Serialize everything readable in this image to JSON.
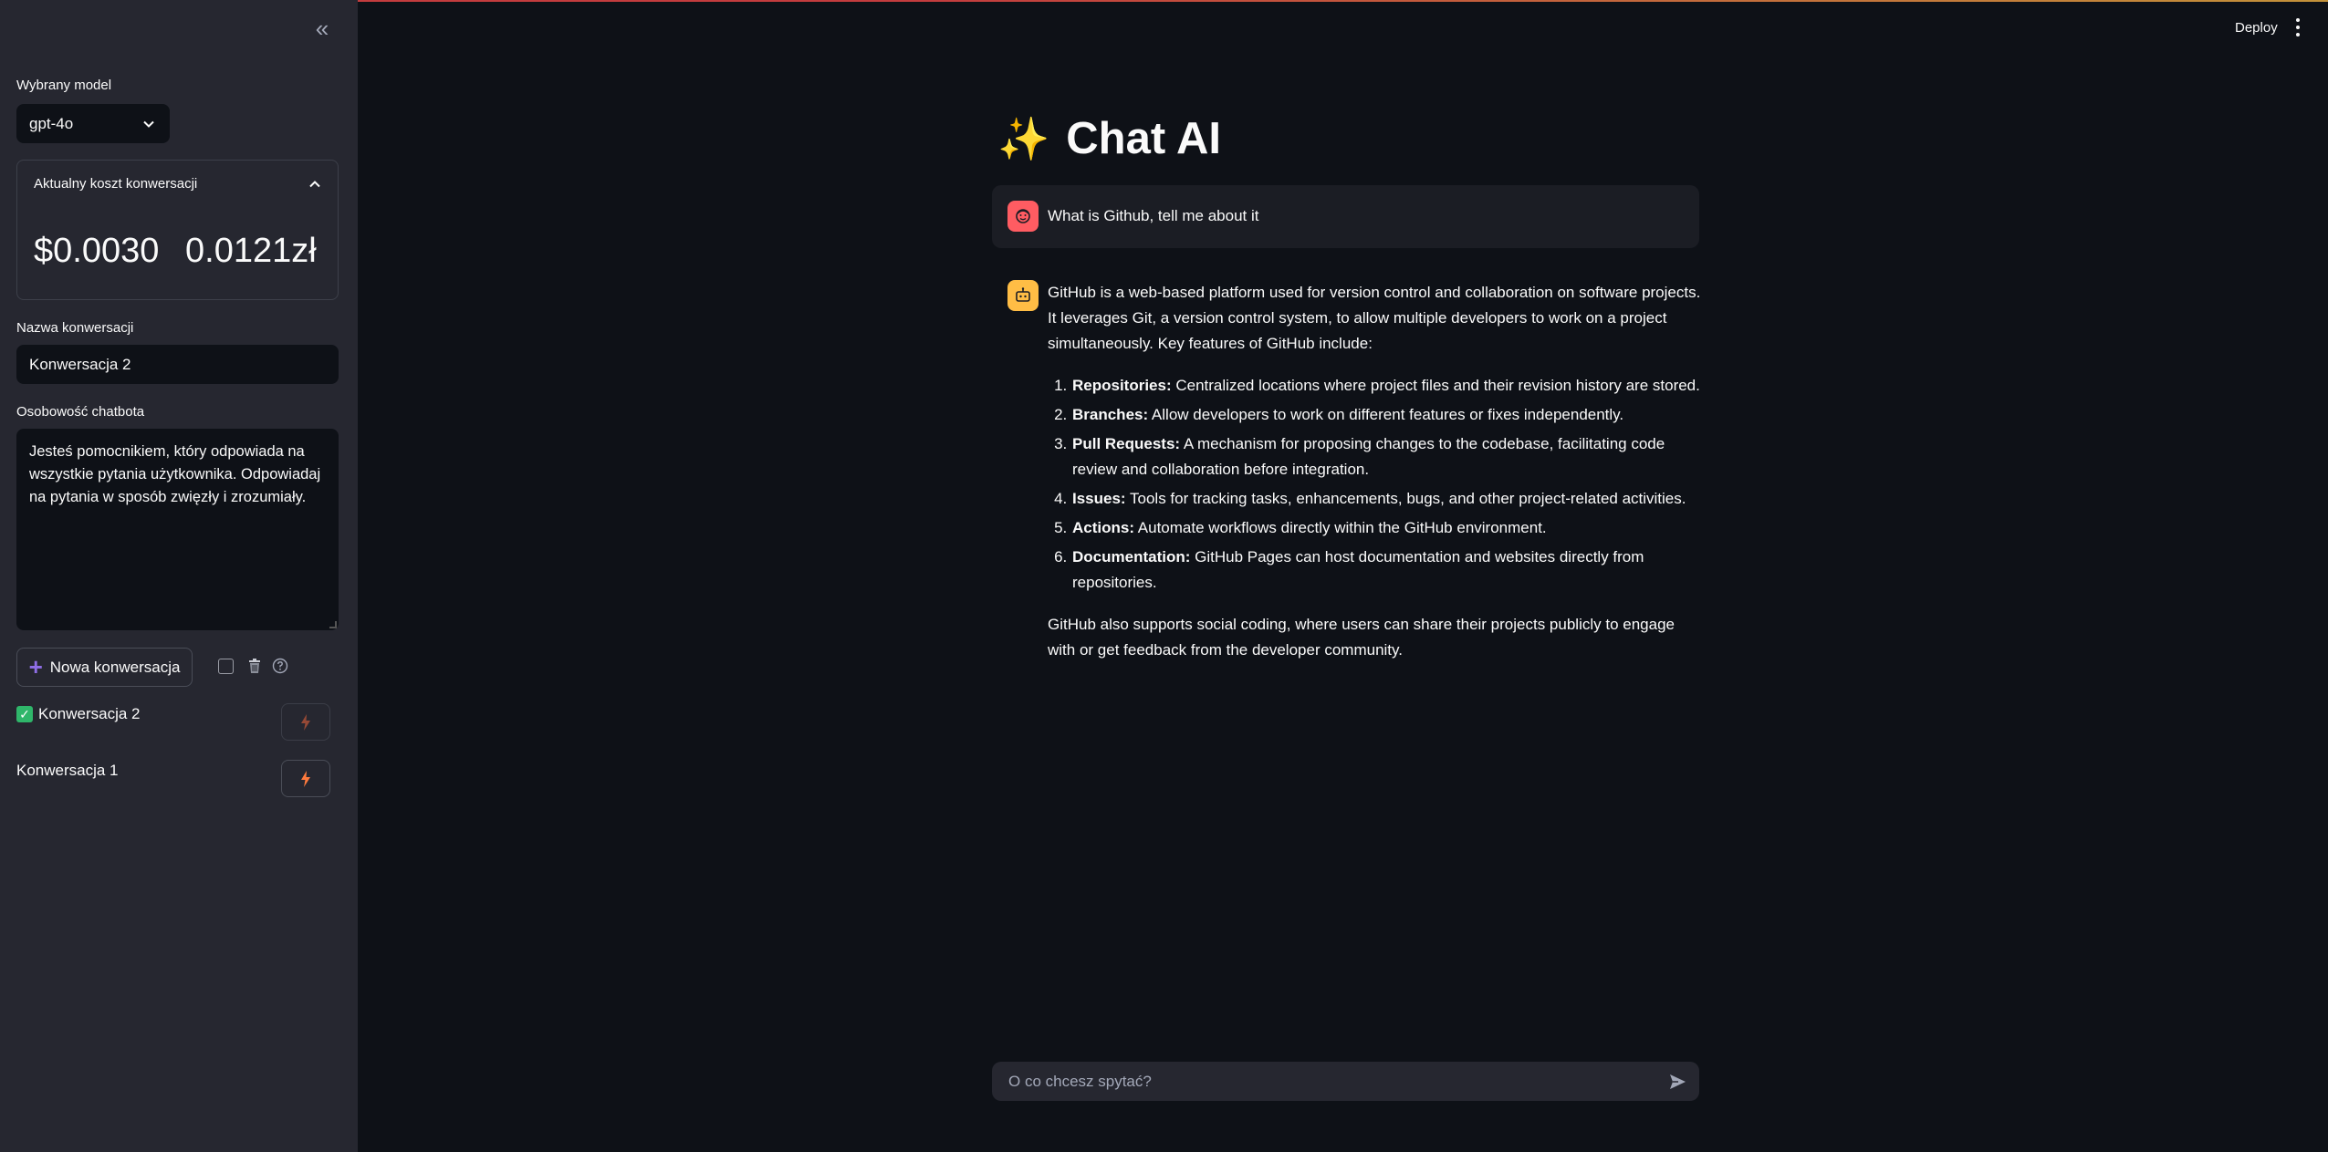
{
  "header": {
    "deploy_label": "Deploy"
  },
  "sidebar": {
    "model_label": "Wybrany model",
    "model_value": "gpt-4o",
    "cost": {
      "title": "Aktualny koszt konwersacji",
      "usd": "$0.0030",
      "pln": "0.0121zł"
    },
    "conv_name_label": "Nazwa konwersacji",
    "conv_name_value": "Konwersacja 2",
    "personality_label": "Osobowość chatbota",
    "personality_value": "Jesteś pomocnikiem, który odpowiada na wszystkie pytania użytkownika. Odpowiadaj na pytania w sposób zwięzły i zrozumiały.",
    "new_conv_label": "Nowa konwersacja",
    "conversations": [
      {
        "name": "Konwersacja 2",
        "active": true
      },
      {
        "name": "Konwersacja 1",
        "active": false
      }
    ]
  },
  "main": {
    "title": "Chat AI",
    "user_message": "What is Github, tell me about it",
    "assistant": {
      "intro": "GitHub is a web-based platform used for version control and collaboration on software projects. It leverages Git, a version control system, to allow multiple developers to work on a project simultaneously. Key features of GitHub include:",
      "features": [
        {
          "term": "Repositories:",
          "desc": " Centralized locations where project files and their revision history are stored."
        },
        {
          "term": "Branches:",
          "desc": " Allow developers to work on different features or fixes independently."
        },
        {
          "term": "Pull Requests:",
          "desc": " A mechanism for proposing changes to the codebase, facilitating code review and collaboration before integration."
        },
        {
          "term": "Issues:",
          "desc": " Tools for tracking tasks, enhancements, bugs, and other project-related activities."
        },
        {
          "term": "Actions:",
          "desc": " Automate workflows directly within the GitHub environment."
        },
        {
          "term": "Documentation:",
          "desc": " GitHub Pages can host documentation and websites directly from repositories."
        }
      ],
      "outro": "GitHub also supports social coding, where users can share their projects publicly to engage with or get feedback from the developer community."
    },
    "input_placeholder": "O co chcesz spytać?"
  },
  "icons": {
    "collapse": "double-chevron-left-icon",
    "chevron_down": "chevron-down-icon",
    "chevron_up": "chevron-up-icon",
    "plus": "plus-icon",
    "trash": "trash-icon",
    "help": "help-icon",
    "check": "check-icon",
    "bolt": "bolt-icon",
    "send": "send-icon",
    "sparkle": "sparkles-icon"
  }
}
